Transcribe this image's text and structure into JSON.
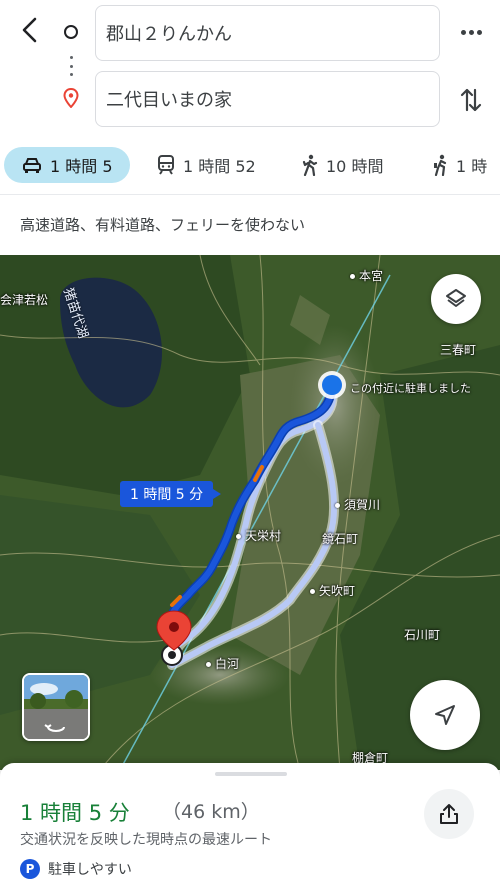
{
  "route": {
    "origin_value": "郡山２りんかん",
    "destination_value": "二代目いまの家"
  },
  "modes": [
    {
      "name": "car",
      "label": "1 時間 5",
      "selected": true
    },
    {
      "name": "transit",
      "label": "1 時間 52",
      "selected": false
    },
    {
      "name": "walk",
      "label": "10 時間",
      "selected": false
    },
    {
      "name": "ride",
      "label": "1 時",
      "selected": false
    }
  ],
  "options_text": "高速道路、有料道路、フェリーを使わない",
  "map": {
    "lake_name": "猪苗代湖",
    "places": {
      "aizu": "会津若松",
      "motomiya": "本宮",
      "miharu": "三春町",
      "parked_note": "この付近に駐車しました",
      "sukagawa": "須賀川",
      "tenei": "天栄村",
      "kagamiishi": "鏡石町",
      "yabuki": "矢吹町",
      "ishikawa": "石川町",
      "shirakawa": "白河",
      "tanagura": "棚倉町"
    },
    "route_duration_tag": "1 時間 5 分"
  },
  "summary": {
    "duration": "1 時間 5 分",
    "distance": "（46 km）",
    "note": "交通状況を反映した現時点の最速ルート",
    "parking_badge": "P",
    "parking_text": "駐車しやすい"
  },
  "colors": {
    "selected_mode_bg": "#b9e4f3",
    "route_primary": "#1a56db",
    "route_alt": "#b8c9f5",
    "duration_green": "#188038",
    "dest_pin": "#ea4335"
  },
  "icons": [
    "back-arrow-icon",
    "origin-circle-icon",
    "destination-pin-icon",
    "more-icon",
    "swap-icon",
    "car-icon",
    "train-icon",
    "walk-icon",
    "ride-icon",
    "layers-icon",
    "navigate-arrow-icon",
    "share-icon",
    "parking-icon"
  ]
}
